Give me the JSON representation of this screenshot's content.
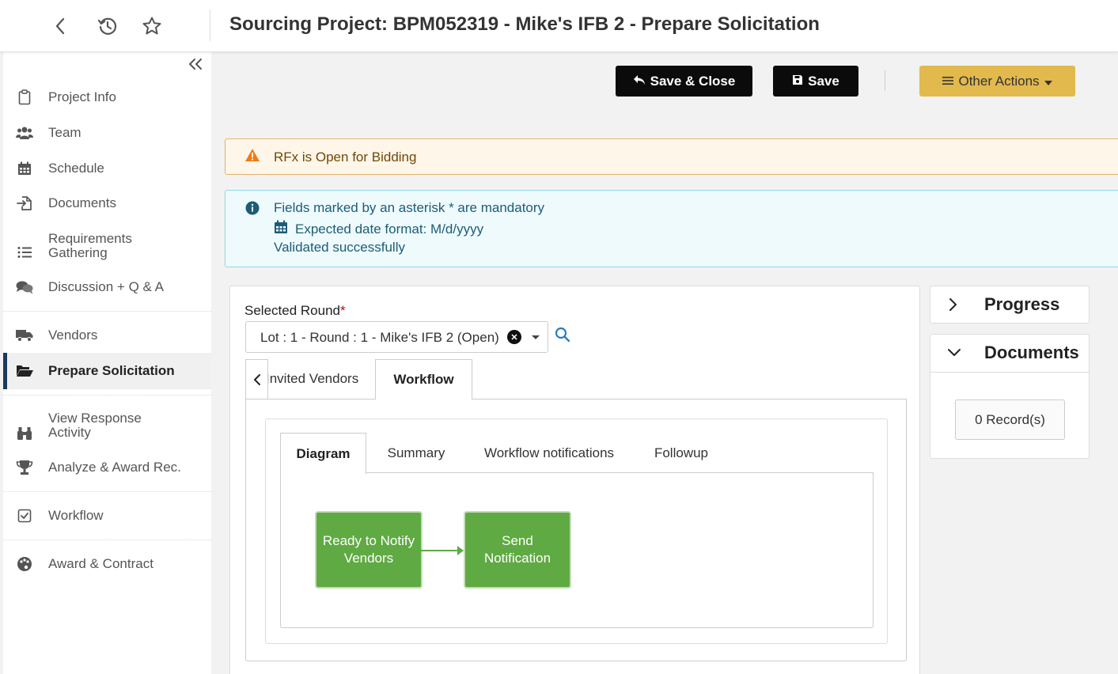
{
  "header": {
    "title": "Sourcing Project: BPM052319 - Mike's IFB 2 - Prepare Solicitation",
    "icons": [
      "back-icon",
      "history-icon",
      "star-icon"
    ]
  },
  "sidebar": {
    "items": [
      {
        "label": "Project Info",
        "icon": "clipboard-icon"
      },
      {
        "label": "Team",
        "icon": "users-icon"
      },
      {
        "label": "Schedule",
        "icon": "calendar-icon"
      },
      {
        "label": "Documents",
        "icon": "file-import-icon"
      },
      {
        "label": "Requirements Gathering",
        "icon": "list-icon"
      },
      {
        "label": "Discussion + Q & A",
        "icon": "comments-icon"
      },
      {
        "label": "Vendors",
        "icon": "truck-icon"
      },
      {
        "label": "Prepare Solicitation",
        "icon": "folder-open-icon",
        "active": true
      },
      {
        "label": "View Response Activity",
        "icon": "binoculars-icon"
      },
      {
        "label": "Analyze & Award Rec.",
        "icon": "trophy-icon"
      },
      {
        "label": "Workflow",
        "icon": "checkbox-icon"
      },
      {
        "label": "Award & Contract",
        "icon": "palette-icon"
      }
    ]
  },
  "toolbar": {
    "save_close_label": "Save & Close",
    "save_label": "Save",
    "other_actions_label": "Other Actions"
  },
  "alerts": {
    "warning": "RFx is Open for Bidding",
    "info_lines": [
      "Fields marked by an asterisk * are mandatory",
      "Expected date format: M/d/yyyy",
      "Validated successfully"
    ]
  },
  "round": {
    "label": "Selected Round",
    "required_mark": "*",
    "value": "Lot : 1 - Round : 1 - Mike's IFB 2 (Open)"
  },
  "tabs": [
    {
      "label": "Invited Vendors",
      "active": false
    },
    {
      "label": "Workflow",
      "active": true
    }
  ],
  "workflow_tabs": [
    {
      "label": "Diagram",
      "active": true
    },
    {
      "label": "Summary",
      "active": false
    },
    {
      "label": "Workflow notifications",
      "active": false
    },
    {
      "label": "Followup",
      "active": false
    }
  ],
  "diagram": {
    "nodes": [
      "Ready to Notify Vendors",
      "Send Notification"
    ],
    "node_color": "#5faa43"
  },
  "panels": {
    "progress": {
      "title": "Progress",
      "expanded": false
    },
    "documents": {
      "title": "Documents",
      "expanded": true,
      "records": "0 Record(s)"
    }
  },
  "colors": {
    "primary_button": "#0b0b0b",
    "accent_button": "#e1b94d",
    "active_nav_bar": "#1b3a5c",
    "warning_icon": "#f07a17",
    "info_icon": "#1d5c78",
    "search_icon": "#2b7ec1"
  }
}
